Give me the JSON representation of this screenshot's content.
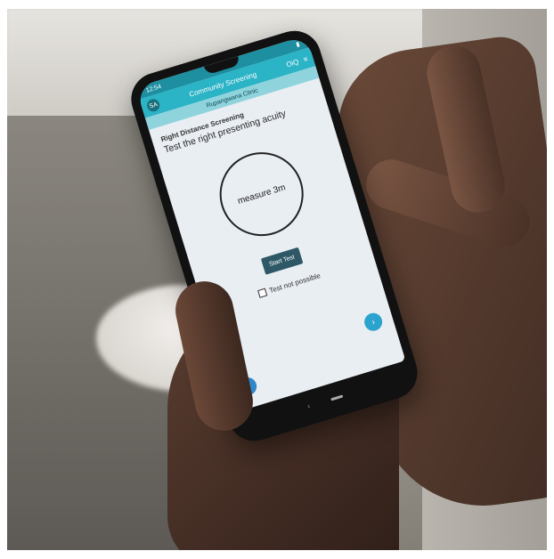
{
  "status": {
    "time": "12:54"
  },
  "appbar": {
    "logo": "SA",
    "title": "Community Screening",
    "right": "OiQ"
  },
  "clinic": {
    "name": "Rupangwana Clinic"
  },
  "screening": {
    "section": "Right Distance Screening",
    "instruction": "Test the right presenting acuity",
    "measure": "measure 3m",
    "start_label": "Start Test",
    "not_possible_label": "Test not possible"
  },
  "fab": {
    "next": "›",
    "back": "‹"
  },
  "navbar": {
    "back": "‹"
  }
}
